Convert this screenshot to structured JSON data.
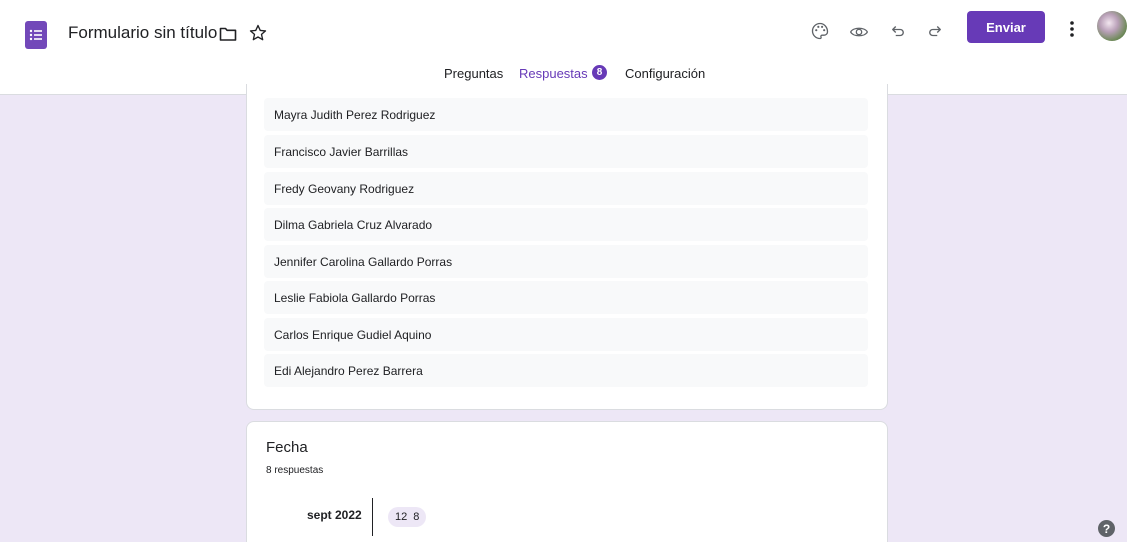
{
  "app": {
    "form_title": "Formulario sin título",
    "send_label": "Enviar",
    "brand_color": "#673ab7",
    "icons": [
      "forms-logo-icon",
      "folder-icon",
      "star-icon",
      "palette-icon",
      "preview-eye-icon",
      "undo-icon",
      "redo-icon",
      "more-vert-icon",
      "help-icon"
    ]
  },
  "tabs": {
    "preguntas": "Preguntas",
    "respuestas": "Respuestas",
    "respuestas_badge": "8",
    "configuracion": "Configuración",
    "active": "Respuestas"
  },
  "names_card": {
    "rows": [
      "Mayra Judith Perez Rodriguez",
      "Francisco Javier Barrillas",
      "Fredy Geovany Rodriguez",
      "Dilma Gabriela Cruz Alvarado",
      "Jennifer Carolina Gallardo Porras",
      "Leslie Fabiola Gallardo Porras",
      "Carlos Enrique Gudiel Aquino",
      "Edi Alejandro Perez Barrera"
    ]
  },
  "fecha_card": {
    "title": "Fecha",
    "count_text": "8 respuestas",
    "month": "sept 2022",
    "day": "12",
    "day_count": "8"
  }
}
